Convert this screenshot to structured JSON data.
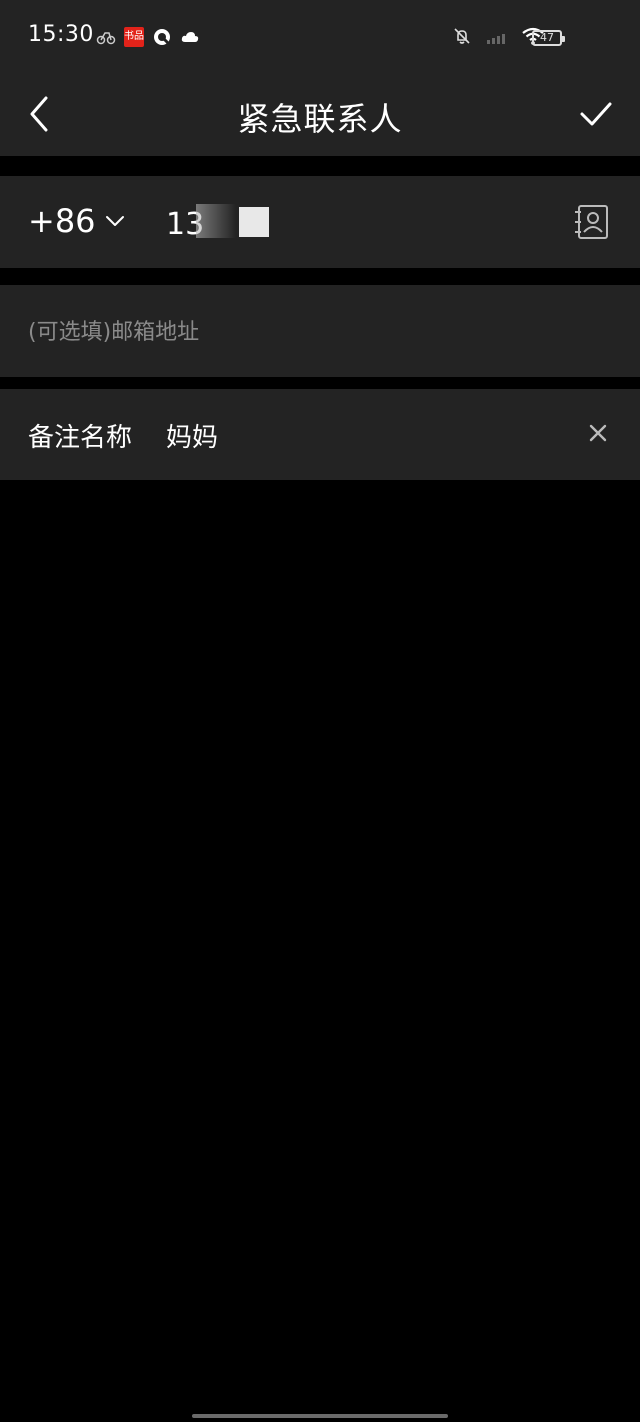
{
  "status": {
    "time": "15:30",
    "battery": "47",
    "badge": "书品"
  },
  "header": {
    "title": "紧急联系人"
  },
  "phone": {
    "country_code": "+86",
    "number_visible": "13"
  },
  "email": {
    "placeholder": "(可选填)邮箱地址"
  },
  "remark": {
    "label": "备注名称",
    "value": "妈妈"
  },
  "colors": {
    "background": "#000000",
    "surface": "#232323",
    "text": "#ffffff",
    "placeholder": "#8a8a8a",
    "badge_red": "#e2231a"
  }
}
